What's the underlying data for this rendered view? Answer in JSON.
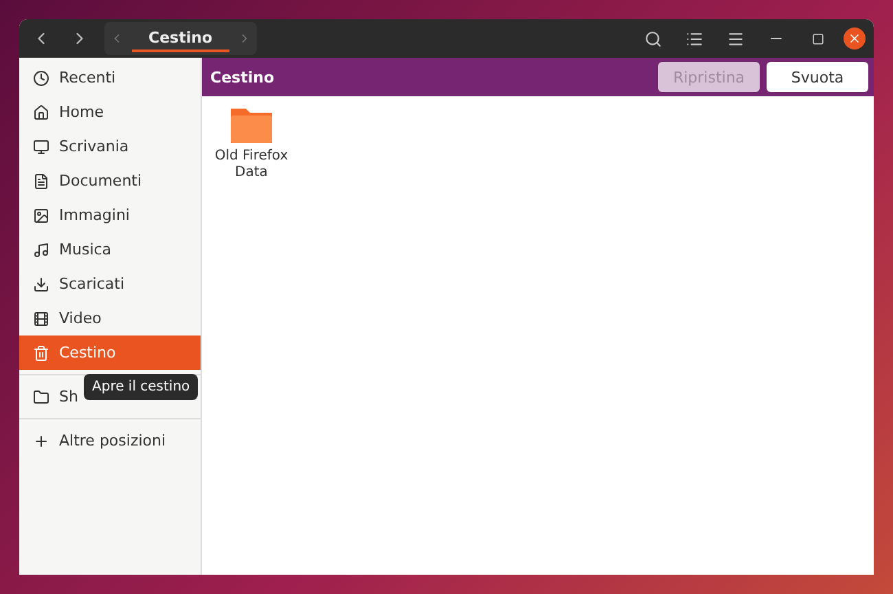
{
  "header": {
    "path": "Cestino"
  },
  "sidebar": {
    "items": [
      {
        "label": "Recenti",
        "selected": false
      },
      {
        "label": "Home",
        "selected": false
      },
      {
        "label": "Scrivania",
        "selected": false
      },
      {
        "label": "Documenti",
        "selected": false
      },
      {
        "label": "Immagini",
        "selected": false
      },
      {
        "label": "Musica",
        "selected": false
      },
      {
        "label": "Scaricati",
        "selected": false
      },
      {
        "label": "Video",
        "selected": false
      },
      {
        "label": "Cestino",
        "selected": true
      }
    ],
    "shared": {
      "label": "Sh"
    },
    "other": {
      "label": "Altre posizioni"
    },
    "tooltip": "Apre il cestino"
  },
  "infobar": {
    "title": "Cestino",
    "buttons": [
      {
        "label": "Ripristina",
        "disabled": true
      },
      {
        "label": "Svuota",
        "disabled": false
      }
    ]
  },
  "files": [
    {
      "name": "Old Firefox Data"
    }
  ]
}
